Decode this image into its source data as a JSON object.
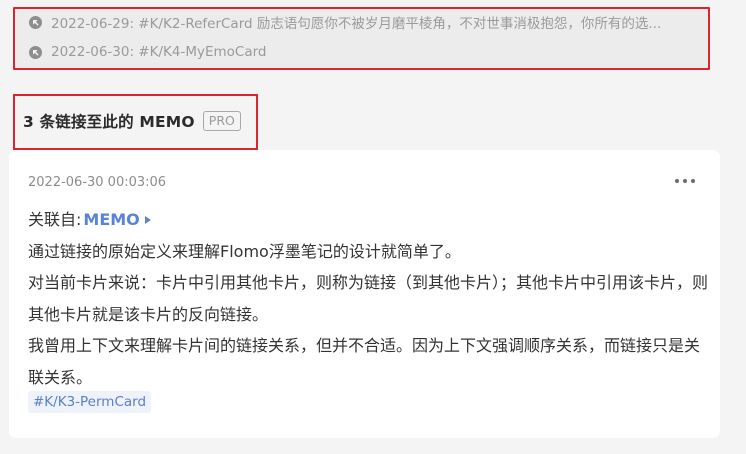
{
  "backlinks": [
    {
      "text": "2022-06-29: #K/K2-ReferCard 励志语句愿你不被岁月磨平棱角，不对世事消极抱怨，你所有的选..."
    },
    {
      "text": "2022-06-30: #K/K4-MyEmoCard"
    }
  ],
  "linked_section": {
    "title": "3 条链接至此的 MEMO",
    "badge": "PRO"
  },
  "memo": {
    "timestamp": "2022-06-30 00:03:06",
    "relate_prefix": "关联自:",
    "relate_link": "MEMO",
    "paragraphs": [
      "通过链接的原始定义来理解Flomo浮墨笔记的设计就简单了。",
      "对当前卡片来说：卡片中引用其他卡片，则称为链接（到其他卡片）；其他卡片中引用该卡片，则其他卡片就是该卡片的反向链接。",
      "我曾用上下文来理解卡片间的链接关系，但并不合适。因为上下文强调顺序关系，而链接只是关联关系。"
    ],
    "tag": "#K/K3-PermCard"
  }
}
